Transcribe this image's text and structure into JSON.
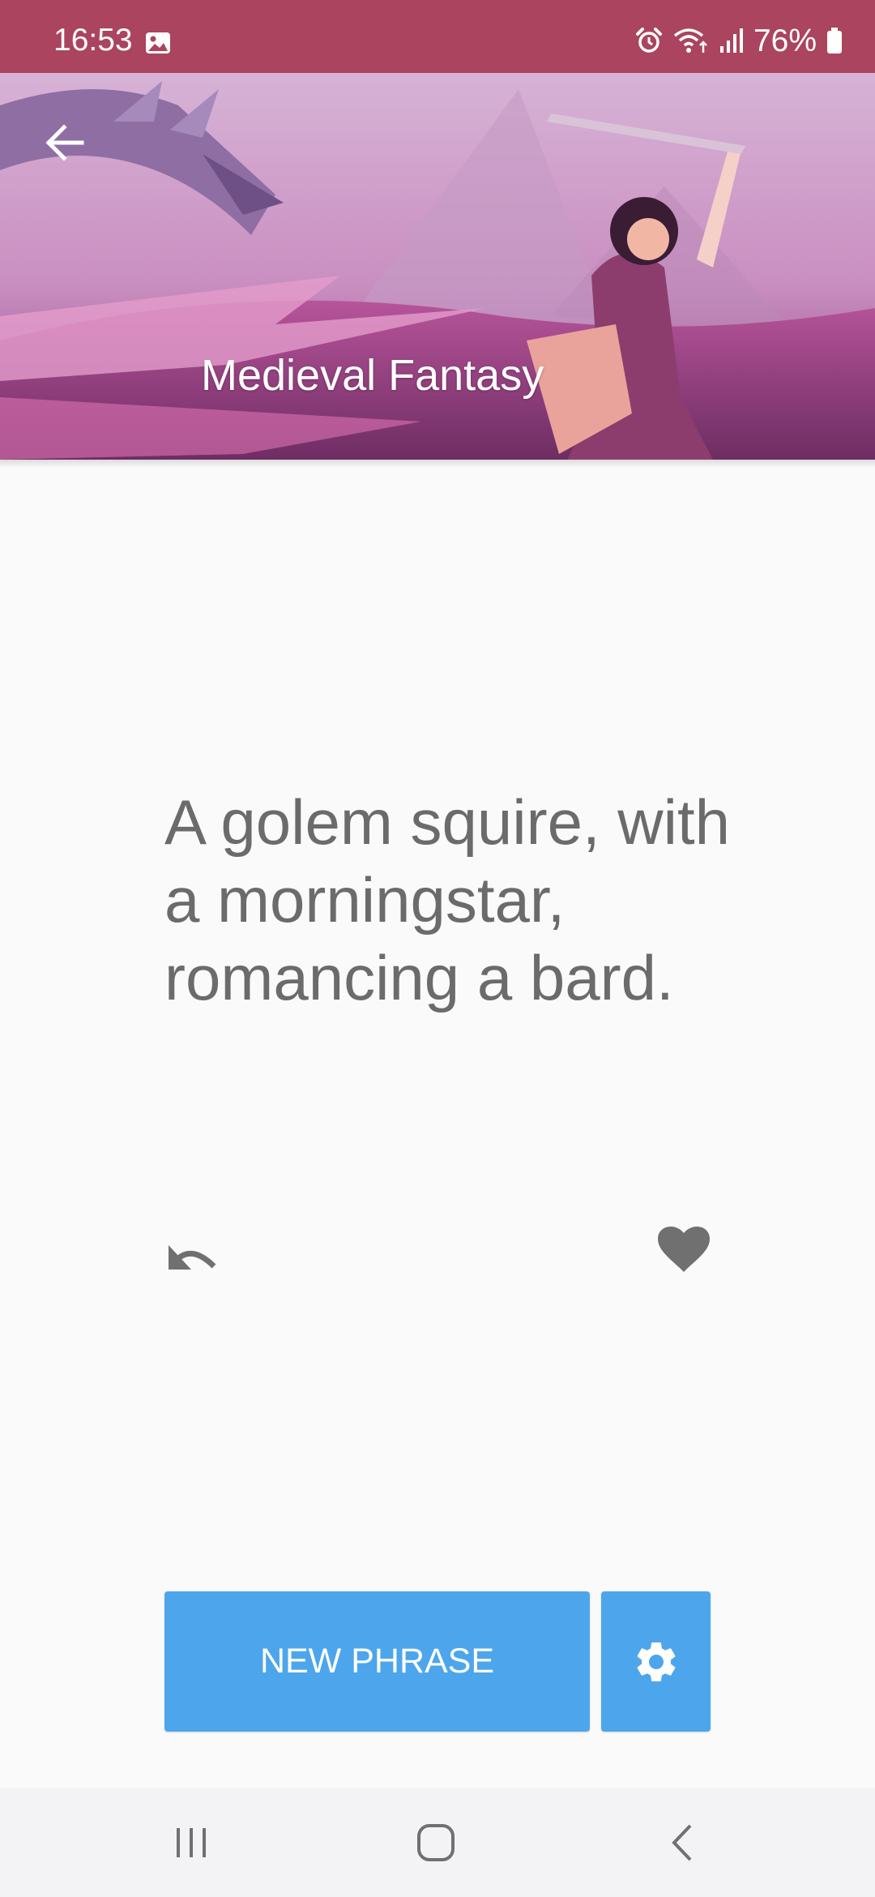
{
  "status_bar": {
    "time": "16:53",
    "battery": "76%"
  },
  "header": {
    "title": "Medieval Fantasy"
  },
  "phrase": {
    "text": "A golem squire, with a morningstar, romancing a bard."
  },
  "actions": {
    "new_phrase_label": "NEW PHRASE"
  },
  "icons": {
    "back": "arrow-left",
    "undo": "undo",
    "favorite": "heart",
    "settings": "gear",
    "nav_recents": "recents",
    "nav_home": "home",
    "nav_back": "back"
  },
  "colors": {
    "status_bar": "#ab445e",
    "accent": "#4da6eb",
    "phrase_text": "#6b6b6b",
    "background": "#fafafa"
  }
}
